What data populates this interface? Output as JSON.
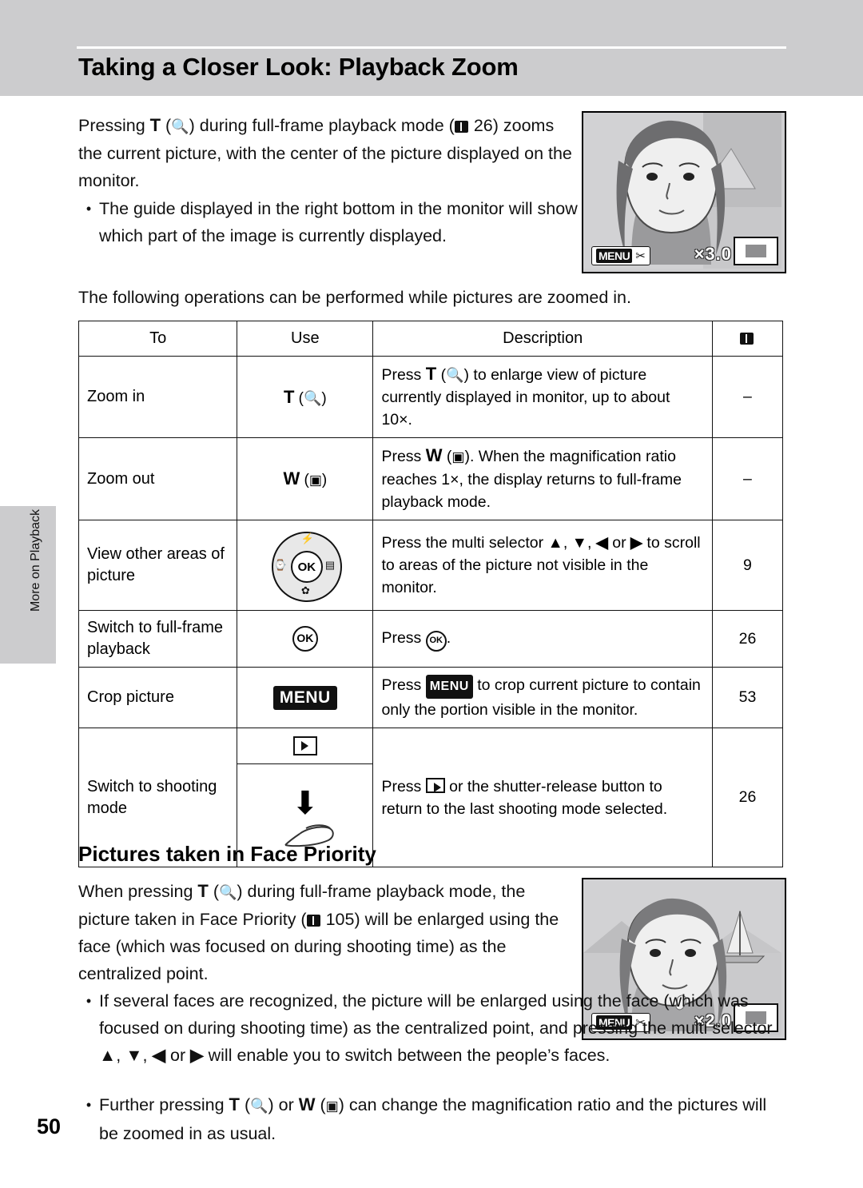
{
  "page": {
    "title": "Taking a Closer Look: Playback Zoom",
    "number": "50",
    "side_tab": "More on Playback"
  },
  "intro": {
    "paragraph": "Pressing T (Q) during full-frame playback mode (A 26) zooms the current picture, with the center of the picture displayed on the monitor.",
    "bullet": "The guide displayed in the right bottom in the monitor will show which part of the image is currently displayed.",
    "following": "The following operations can be performed while pictures are zoomed in."
  },
  "screenshot1": {
    "menu_label": "MENU",
    "scissors_icon": "scissors-icon",
    "zoom_ratio": "×3.0"
  },
  "screenshot2": {
    "menu_label": "MENU",
    "scissors_icon": "scissors-icon",
    "zoom_ratio": "×2.0"
  },
  "table": {
    "headers": {
      "to": "To",
      "use": "Use",
      "description": "Description",
      "page": "book-icon"
    },
    "rows": [
      {
        "to": "Zoom in",
        "use": "T (Q)",
        "description": "Press T (Q) to enlarge view of picture currently displayed in monitor, up to about 10×.",
        "page": "–"
      },
      {
        "to": "Zoom out",
        "use": "W (H)",
        "description": "Press W (H). When the magnification ratio reaches 1×, the display returns to full-frame playback mode.",
        "page": "–"
      },
      {
        "to": "View other areas of picture",
        "use": "multi-selector",
        "description": "Press the multi selector H, I, J or K to scroll to areas of the picture not visible in the monitor.",
        "page": "9"
      },
      {
        "to": "Switch to full-frame playback",
        "use": "k",
        "description": "Press k.",
        "page": "26"
      },
      {
        "to": "Crop picture",
        "use": "MENU",
        "description": "Press d to crop current picture to contain only the portion visible in the monitor.",
        "page": "53"
      },
      {
        "to": "Switch to shooting mode",
        "use": "playback-button-shutter",
        "description": "Press c or the shutter-release button to return to the last shooting mode selected.",
        "page": "26"
      }
    ]
  },
  "section2": {
    "heading": "Pictures taken in Face Priority",
    "paragraph": "When pressing T (Q) during full-frame playback mode, the picture taken in Face Priority (A 105) will be enlarged using the face (which was focused on during shooting time) as the centralized point.",
    "bullet1": "If several faces are recognized, the picture will be enlarged using the face (which was focused on during shooting time) as the centralized point, and pressing the multi selector H, I, J or K will enable you to switch between the people's faces.",
    "bullet2": "Further pressing T (Q) or W (H) can change the magnification ratio and the pictures will be zoomed in as usual."
  }
}
